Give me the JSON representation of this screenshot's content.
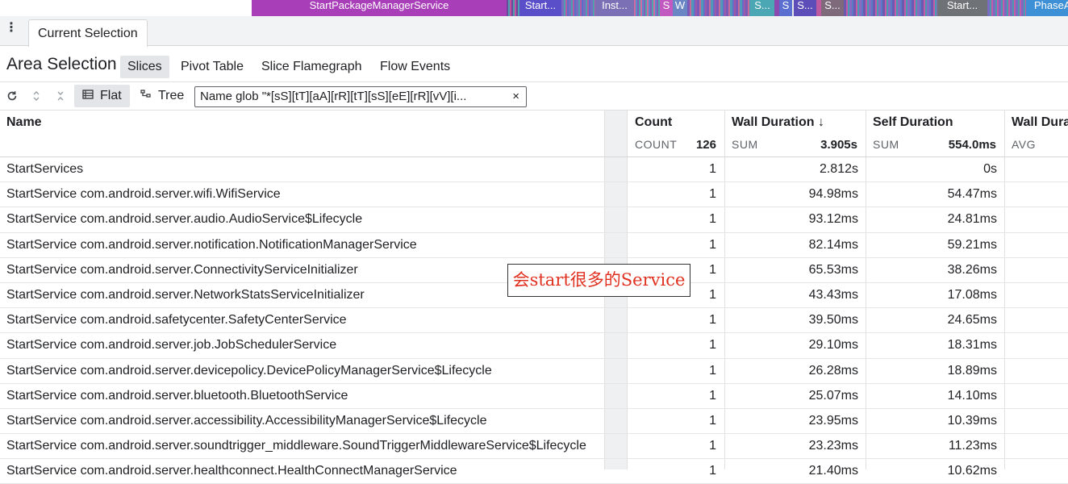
{
  "timeline": {
    "segments": [
      {
        "label": "StartPackageManagerService",
        "color": "#a83fb8"
      },
      {
        "label": "Start...",
        "color": "#5b4fc9"
      },
      {
        "label": "Inst...",
        "color": "#7b6fb5"
      },
      {
        "label": "S",
        "color": "#c259c0"
      },
      {
        "label": "W",
        "color": "#6a86c4"
      },
      {
        "label": "S...",
        "color": "#4aa7b3"
      },
      {
        "label": "S",
        "color": "#5a6fd0"
      },
      {
        "label": "S...",
        "color": "#5c4db8"
      },
      {
        "label": "S...",
        "color": "#7e6a7a"
      },
      {
        "label": "Start...",
        "color": "#6f7377"
      },
      {
        "label": "PhaseA",
        "color": "#3d8fd6"
      }
    ]
  },
  "tabbar": {
    "menu_icon": "kebab-menu-icon",
    "tab_label": "Current Selection"
  },
  "area": {
    "title": "Area Selection",
    "tabs": [
      {
        "label": "Slices",
        "active": true
      },
      {
        "label": "Pivot Table",
        "active": false
      },
      {
        "label": "Slice Flamegraph",
        "active": false
      },
      {
        "label": "Flow Events",
        "active": false
      }
    ]
  },
  "toolbar": {
    "icons": [
      "refresh-icon",
      "expand-icon",
      "collapse-icon"
    ],
    "flat_label": "Flat",
    "tree_label": "Tree",
    "filter_text": "Name glob \"*[sS][tT][aA][rR][tT][sS][eE][rR][vV][i...",
    "filter_close": "×"
  },
  "table": {
    "columns": [
      {
        "label": "Name",
        "agg_label": "",
        "agg_value": ""
      },
      {
        "label": "Count",
        "agg_label": "COUNT",
        "agg_value": "126"
      },
      {
        "label": "Wall Duration ↓",
        "agg_label": "SUM",
        "agg_value": "3.905s"
      },
      {
        "label": "Self Duration",
        "agg_label": "SUM",
        "agg_value": "554.0ms"
      },
      {
        "label": "Wall Dura",
        "agg_label": "AVG",
        "agg_value": ""
      }
    ],
    "rows": [
      {
        "name": "StartServices",
        "count": "1",
        "wall": "2.812s",
        "self": "0s"
      },
      {
        "name": "StartService com.android.server.wifi.WifiService",
        "count": "1",
        "wall": "94.98ms",
        "self": "54.47ms"
      },
      {
        "name": "StartService com.android.server.audio.AudioService$Lifecycle",
        "count": "1",
        "wall": "93.12ms",
        "self": "24.81ms"
      },
      {
        "name": "StartService com.android.server.notification.NotificationManagerService",
        "count": "1",
        "wall": "82.14ms",
        "self": "59.21ms"
      },
      {
        "name": "StartService com.android.server.ConnectivityServiceInitializer",
        "count": "1",
        "wall": "65.53ms",
        "self": "38.26ms"
      },
      {
        "name": "StartService com.android.server.NetworkStatsServiceInitializer",
        "count": "1",
        "wall": "43.43ms",
        "self": "17.08ms"
      },
      {
        "name": "StartService com.android.safetycenter.SafetyCenterService",
        "count": "1",
        "wall": "39.50ms",
        "self": "24.65ms"
      },
      {
        "name": "StartService com.android.server.job.JobSchedulerService",
        "count": "1",
        "wall": "29.10ms",
        "self": "18.31ms"
      },
      {
        "name": "StartService com.android.server.devicepolicy.DevicePolicyManagerService$Lifecycle",
        "count": "1",
        "wall": "26.28ms",
        "self": "18.89ms"
      },
      {
        "name": "StartService com.android.server.bluetooth.BluetoothService",
        "count": "1",
        "wall": "25.07ms",
        "self": "14.10ms"
      },
      {
        "name": "StartService com.android.server.accessibility.AccessibilityManagerService$Lifecycle",
        "count": "1",
        "wall": "23.95ms",
        "self": "10.39ms"
      },
      {
        "name": "StartService com.android.server.soundtrigger_middleware.SoundTriggerMiddlewareService$Lifecycle",
        "count": "1",
        "wall": "23.23ms",
        "self": "11.23ms"
      },
      {
        "name": "StartService com.android.server.healthconnect.HealthConnectManagerService",
        "count": "1",
        "wall": "21.40ms",
        "self": "10.62ms"
      }
    ]
  },
  "annotation": {
    "text": "会start很多的Service",
    "color": "#e03020"
  }
}
